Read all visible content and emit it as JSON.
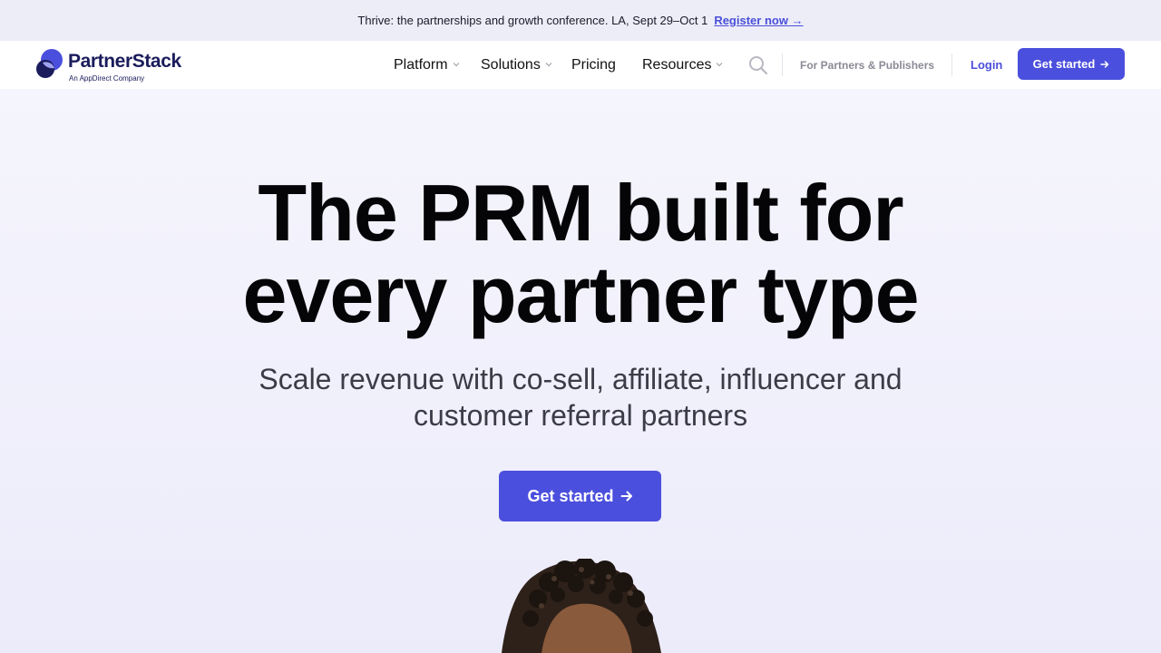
{
  "announcement": {
    "text": "Thrive: the partnerships and growth conference. LA, Sept 29–Oct 1",
    "link_label": "Register now →"
  },
  "header": {
    "logo_name": "PartnerStack",
    "logo_sub": "An AppDirect Company",
    "nav": [
      {
        "label": "Platform",
        "has_dropdown": true
      },
      {
        "label": "Solutions",
        "has_dropdown": true
      },
      {
        "label": "Pricing",
        "has_dropdown": false
      },
      {
        "label": "Resources",
        "has_dropdown": true
      }
    ],
    "partners_link": "For Partners & Publishers",
    "login": "Login",
    "cta": "Get started"
  },
  "hero": {
    "title_line1": "The PRM built for",
    "title_line2": "every partner type",
    "subtitle_line1": "Scale revenue with co-sell, affiliate, influencer and",
    "subtitle_line2": "customer referral partners",
    "cta": "Get started"
  },
  "icons": {
    "logo": "partnerstack-logo-icon",
    "search": "search-icon",
    "dropdown": "chevron-down-icon",
    "arrow": "arrow-right-icon"
  },
  "colors": {
    "accent": "#4b4fdd",
    "brand_navy": "#1a1c5c",
    "announcement_bg": "#ededf8",
    "hero_bg": "#f3f3fb"
  }
}
